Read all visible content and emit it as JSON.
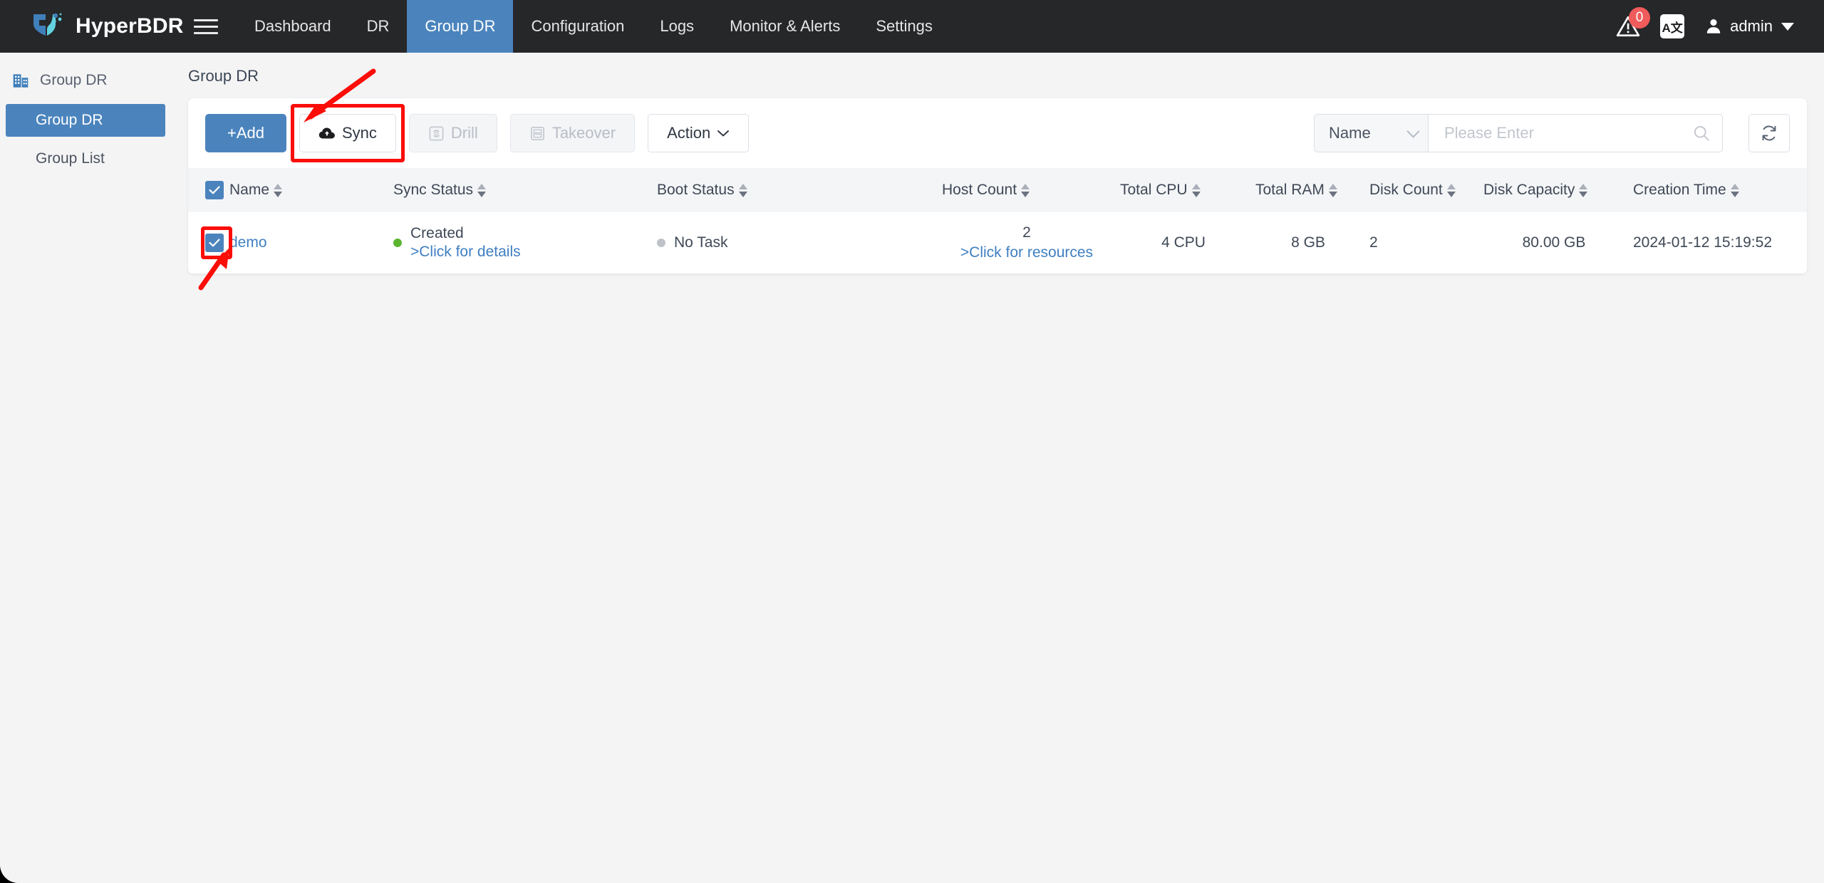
{
  "topbar": {
    "brand": "HyperBDR",
    "menu_icon": "hamburger-icon",
    "nav": [
      {
        "label": "Dashboard",
        "active": false
      },
      {
        "label": "DR",
        "active": false
      },
      {
        "label": "Group DR",
        "active": true
      },
      {
        "label": "Configuration",
        "active": false
      },
      {
        "label": "Logs",
        "active": false
      },
      {
        "label": "Monitor & Alerts",
        "active": false
      },
      {
        "label": "Settings",
        "active": false
      }
    ],
    "alert_badge": "0",
    "lang_label": "A文",
    "user": "admin",
    "accent": "#4b84bd"
  },
  "sidebar": {
    "header": "Group DR",
    "items": [
      {
        "label": "Group DR",
        "active": true
      },
      {
        "label": "Group List",
        "active": false
      }
    ]
  },
  "breadcrumb": "Group DR",
  "toolbar": {
    "add_label": "+Add",
    "sync_label": "Sync",
    "drill_label": "Drill",
    "takeover_label": "Takeover",
    "action_label": "Action"
  },
  "search": {
    "field": "Name",
    "placeholder": "Please Enter"
  },
  "table": {
    "columns": [
      {
        "key": "name",
        "label": "Name"
      },
      {
        "key": "sync_status",
        "label": "Sync Status"
      },
      {
        "key": "boot_status",
        "label": "Boot Status"
      },
      {
        "key": "host_count",
        "label": "Host Count"
      },
      {
        "key": "total_cpu",
        "label": "Total CPU"
      },
      {
        "key": "total_ram",
        "label": "Total RAM"
      },
      {
        "key": "disk_count",
        "label": "Disk Count"
      },
      {
        "key": "disk_capacity",
        "label": "Disk Capacity"
      },
      {
        "key": "creation_time",
        "label": "Creation Time"
      }
    ],
    "rows": [
      {
        "selected": true,
        "name": "demo",
        "sync_status": "Created",
        "sync_status_link": ">Click for details",
        "sync_status_color": "#5cb531",
        "boot_status": "No Task",
        "boot_status_color": "#bfc3c9",
        "host_count": "2",
        "host_count_link": ">Click for resources",
        "total_cpu": "4 CPU",
        "total_ram": "8 GB",
        "disk_count": "2",
        "disk_capacity": "80.00 GB",
        "creation_time": "2024-01-12 15:19:52"
      }
    ]
  },
  "annotations": {
    "highlight_color": "#fb0d08",
    "sync_button_highlight": true,
    "row_checkbox_highlight": true
  }
}
